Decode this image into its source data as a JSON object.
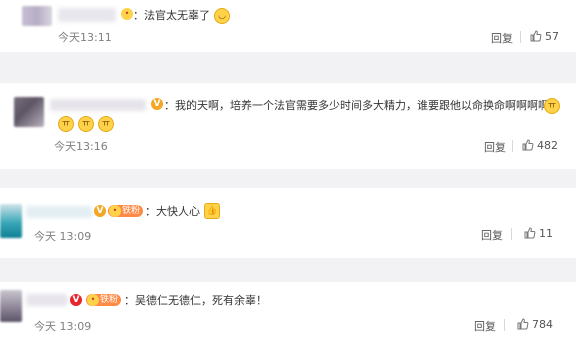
{
  "comments": [
    {
      "text": "：法官太无辜了",
      "time": "今天13:11",
      "reply": "回复",
      "likes": "57",
      "emojis": [
        "smile"
      ]
    },
    {
      "text": "：我的天啊，培养一个法官需要多少时间多大精力，谁要跟他以命换命啊啊啊啊",
      "time": "今天13:16",
      "reply": "回复",
      "likes": "482",
      "emojis": [
        "cry",
        "cry",
        "cry",
        "cry"
      ]
    },
    {
      "fan_badge": "铁粉",
      "text": "：大快人心",
      "time": "今天 13:09",
      "reply": "回复",
      "likes": "11",
      "emojis": [
        "thumbs-up"
      ]
    },
    {
      "fan_badge": "铁粉",
      "text": "：吴德仁无德仁，死有余辜！",
      "time": "今天 13:09",
      "reply": "回复",
      "likes": "784"
    }
  ],
  "colors": {
    "background": "#f2f2f5",
    "card": "#ffffff",
    "vip_badge": "#f5a623",
    "fan_badge": "#ff8a45"
  }
}
